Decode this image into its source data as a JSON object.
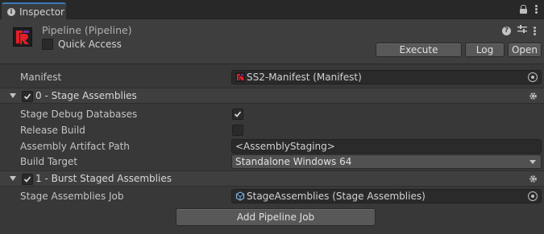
{
  "tab": {
    "icon": "info-icon",
    "label": "Inspector"
  },
  "header": {
    "title": "Pipeline (Pipeline)",
    "quick_access_label": "Quick Access",
    "quick_access_checked": false,
    "buttons": {
      "execute": "Execute",
      "log": "Log",
      "open": "Open"
    }
  },
  "manifest": {
    "label": "Manifest",
    "value": "SS2-Manifest (Manifest)"
  },
  "sections": [
    {
      "label": "0 - Stage Assemblies",
      "enabled": true,
      "fields": {
        "stage_debug_databases": {
          "label": "Stage Debug Databases",
          "checked": true
        },
        "release_build": {
          "label": "Release Build",
          "checked": false
        },
        "assembly_artifact_path": {
          "label": "Assembly Artifact Path",
          "value": "<AssemblyStaging>"
        },
        "build_target": {
          "label": "Build Target",
          "value": "Standalone Windows 64"
        }
      }
    },
    {
      "label": "1 - Burst Staged Assemblies",
      "enabled": true,
      "fields": {
        "stage_assemblies_job": {
          "label": "Stage Assemblies Job",
          "value": "StageAssemblies (Stage Assemblies)"
        }
      }
    }
  ],
  "add_button": "Add Pipeline Job",
  "colors": {
    "accent": "#3a79bb",
    "logo_red": "#e0202a",
    "logo_purple": "#7a2a9a"
  }
}
